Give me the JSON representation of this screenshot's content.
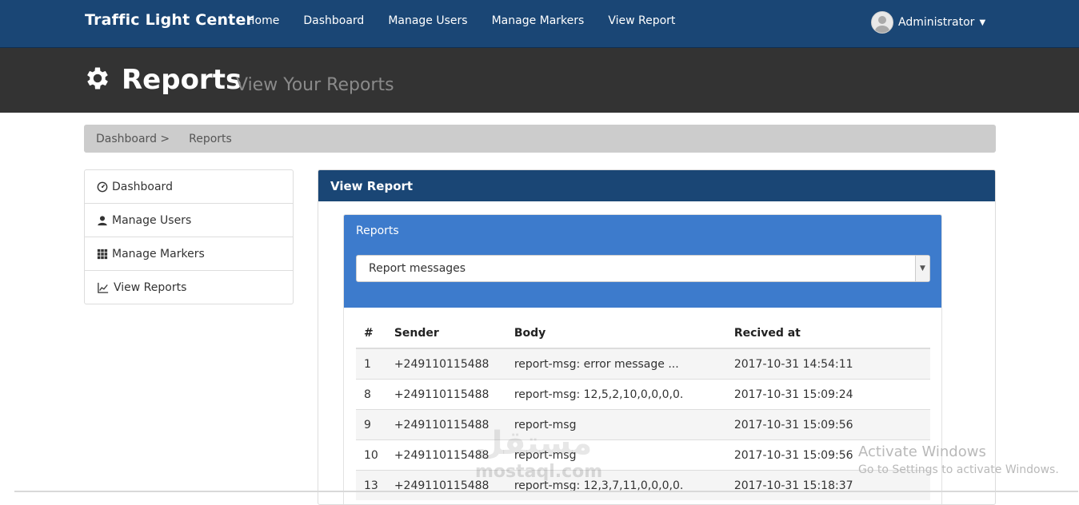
{
  "nav": {
    "brand": "Traffic Light Center",
    "links": [
      "Home",
      "Dashboard",
      "Manage Users",
      "Manage Markers",
      "View Report"
    ],
    "user": "Administrator"
  },
  "header": {
    "title": "Reports",
    "subtitle": "View Your Reports",
    "icon": "gear-icon"
  },
  "breadcrumb": {
    "items": [
      "Dashboard >",
      "Reports"
    ]
  },
  "sidebar": {
    "items": [
      {
        "label": "Dashboard",
        "icon": "dashboard-icon"
      },
      {
        "label": "Manage Users",
        "icon": "user-icon"
      },
      {
        "label": "Manage Markers",
        "icon": "grid-icon"
      },
      {
        "label": "View Reports",
        "icon": "line-chart-icon"
      }
    ]
  },
  "panel": {
    "heading": "View Report",
    "inner_title": "Reports",
    "select_value": "Report messages"
  },
  "table": {
    "columns": [
      "#",
      "Sender",
      "Body",
      "Recived at"
    ],
    "rows": [
      [
        "1",
        "+249110115488",
        "report-msg: error message ...",
        "2017-10-31 14:54:11"
      ],
      [
        "8",
        "+249110115488",
        "report-msg: 12,5,2,10,0,0,0,0.",
        "2017-10-31 15:09:24"
      ],
      [
        "9",
        "+249110115488",
        "report-msg",
        "2017-10-31 15:09:56"
      ],
      [
        "10",
        "+249110115488",
        "report-msg",
        "2017-10-31 15:09:56"
      ],
      [
        "13",
        "+249110115488",
        "report-msg: 12,3,7,11,0,0,0,0.",
        "2017-10-31 15:18:37"
      ]
    ]
  },
  "watermark": {
    "windows_title": "Activate Windows",
    "windows_sub": "Go to Settings to activate Windows.",
    "brand": "مستقل",
    "brand_sub": "mostaql.com"
  },
  "colors": {
    "nav": "#1a4675",
    "header": "#333333",
    "accent": "#3d7bcc"
  }
}
